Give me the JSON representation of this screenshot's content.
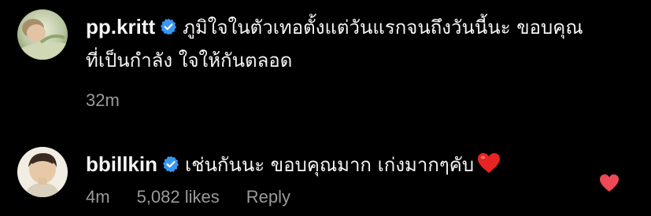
{
  "comments": [
    {
      "username": "pp.kritt",
      "verified_icon": "verified-badge-icon",
      "text_line1": "ภูมิใจในตัวเทอตั้งแต่วันแรกจนถึงวันนี้นะ ขอบคุณ",
      "text_line2": "ที่เป็นกำลัง ใจให้กันตลอด",
      "time": "32m"
    },
    {
      "username": "bbillkin",
      "verified_icon": "verified-badge-icon",
      "text_line1": "เช่นกันนะ ขอบคุณมาก เก่งมากๆคับ",
      "emoji_icon": "red-heart-emoji-icon",
      "time": "4m",
      "likes": "5,082 likes",
      "reply": "Reply",
      "like_icon": "heart-liked-icon"
    }
  ],
  "colors": {
    "background": "#000000",
    "text": "#f5f5f5",
    "muted": "#9a9a9a",
    "verified_blue": "#3897f0",
    "like_red": "#ed4956"
  }
}
